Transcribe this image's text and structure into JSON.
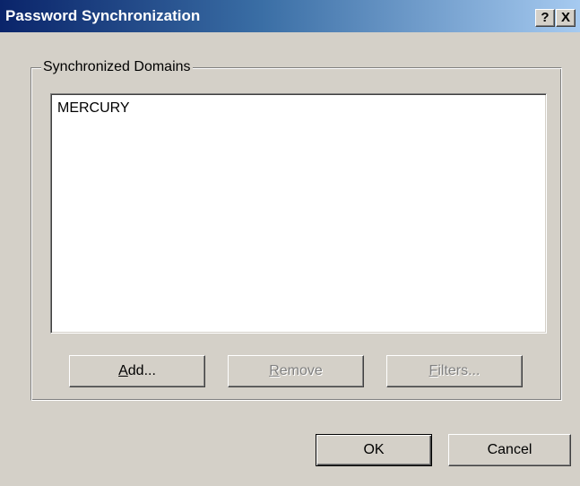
{
  "window": {
    "title": "Password Synchronization",
    "help_glyph": "?",
    "close_glyph": "X"
  },
  "group": {
    "label": "Synchronized Domains",
    "items": [
      "MERCURY"
    ]
  },
  "buttons": {
    "add": {
      "mnemonic": "A",
      "rest": "dd...",
      "enabled": true
    },
    "remove": {
      "mnemonic": "R",
      "rest": "emove",
      "enabled": false
    },
    "filters": {
      "mnemonic": "F",
      "rest": "ilters...",
      "enabled": false
    },
    "ok": "OK",
    "cancel": "Cancel"
  },
  "colors": {
    "titlebar_start": "#0a246a",
    "titlebar_end": "#a6caf0",
    "face": "#d4d0c8",
    "disabled_text": "#808080"
  }
}
